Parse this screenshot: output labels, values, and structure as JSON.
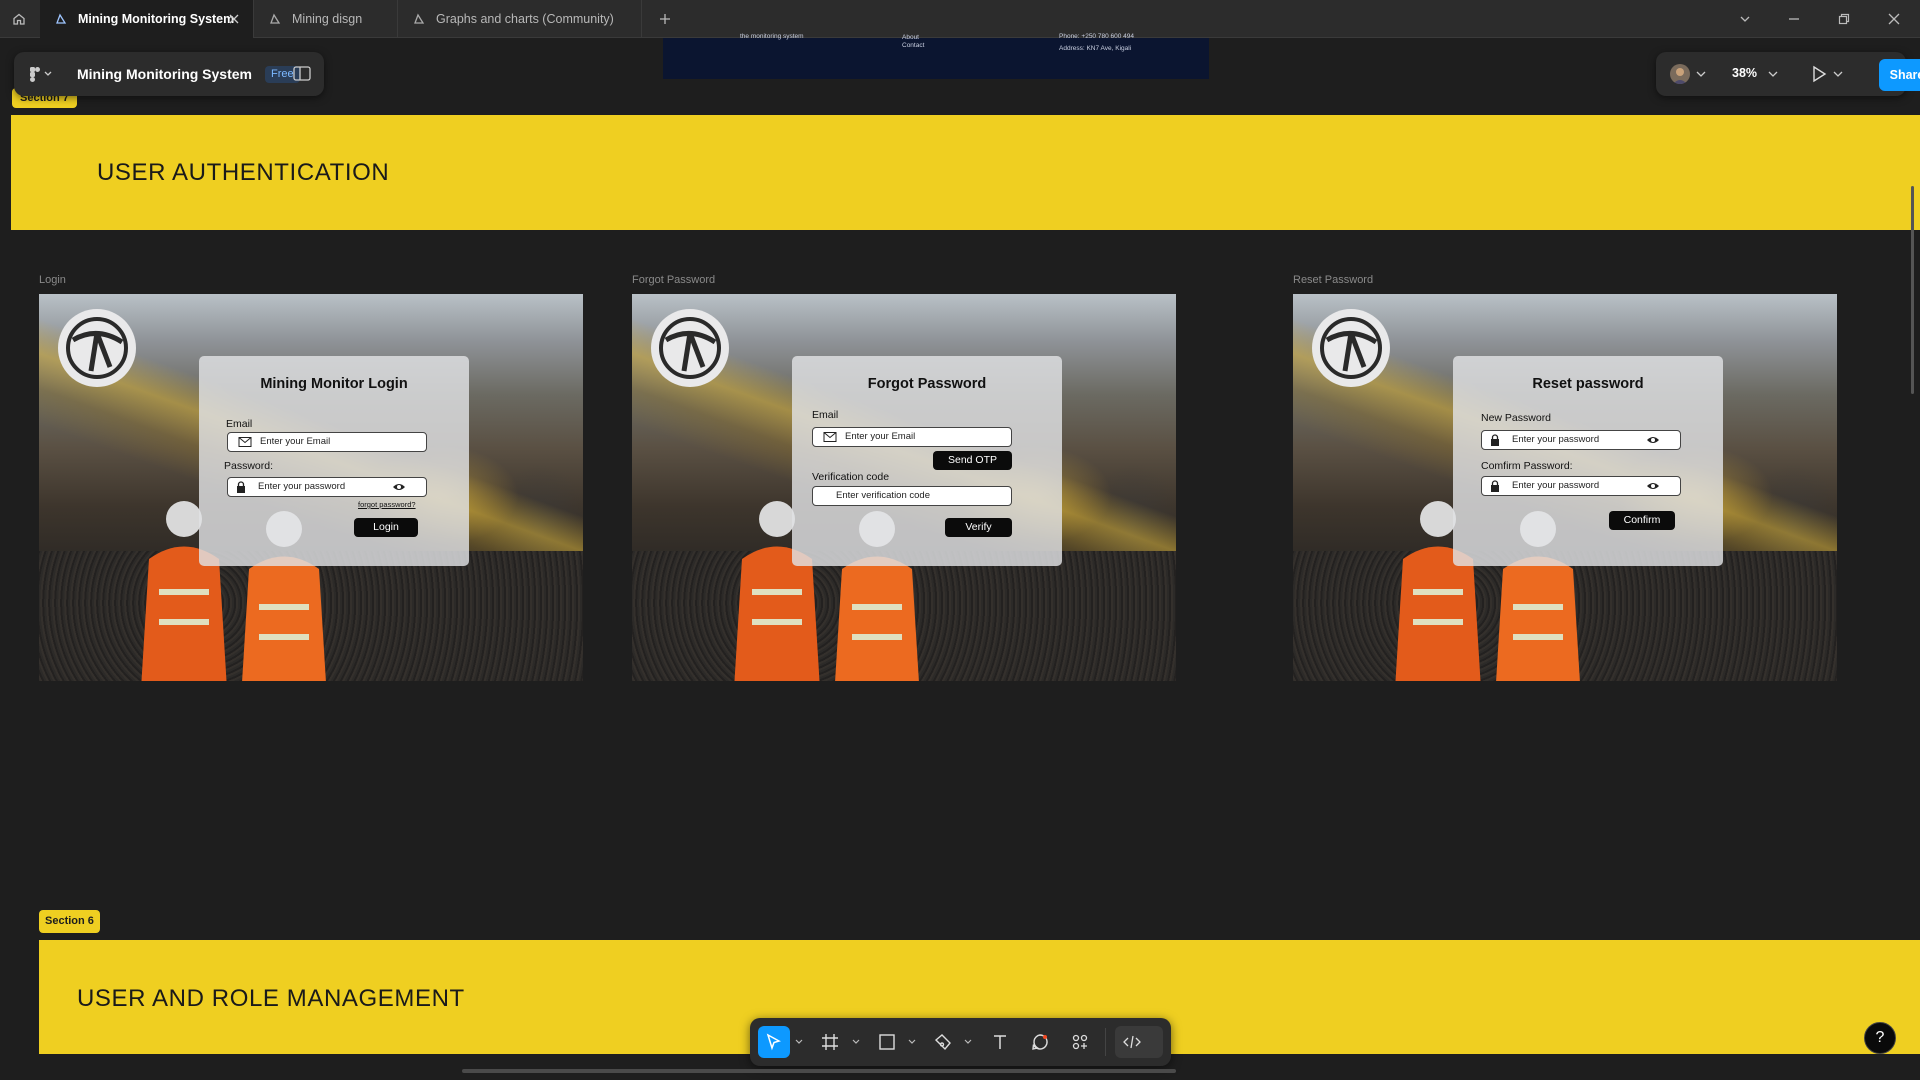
{
  "tabs": [
    {
      "label": "Mining Monitoring System",
      "active": true
    },
    {
      "label": "Mining disgn",
      "active": false
    },
    {
      "label": "Graphs and charts (Community)",
      "active": false
    }
  ],
  "file": {
    "name": "Mining Monitoring System",
    "plan_badge": "Free"
  },
  "view": {
    "zoom": "38%",
    "share_label": "Share"
  },
  "footer_peek": {
    "col1": "the monitoring system",
    "col2a": "About",
    "col2b": "Contact",
    "col3a": "Phone: +250 780 600 494",
    "col3b": "Address: KN7 Ave, Kigali"
  },
  "sections": {
    "section7": {
      "badge": "Section 7",
      "title": "USER AUTHENTICATION"
    },
    "section6": {
      "badge": "Section 6",
      "title": "USER AND ROLE MANAGEMENT"
    }
  },
  "frames": {
    "login": {
      "frame_label": "Login",
      "title": "Mining Monitor Login",
      "email_label": "Email",
      "email_placeholder": "Enter your  Email",
      "password_label": "Password:",
      "password_placeholder": "Enter your password",
      "forgot_link": "forgot password?",
      "button": "Login"
    },
    "forgot": {
      "frame_label": "Forgot Password",
      "title": "Forgot Password",
      "email_label": "Email",
      "email_placeholder": "Enter your  Email",
      "send_button": "Send OTP",
      "code_label": "Verification code",
      "code_placeholder": "Enter  verification code",
      "verify_button": "Verify"
    },
    "reset": {
      "frame_label": "Reset Password",
      "title": "Reset password",
      "new_label": "New Password",
      "new_placeholder": "Enter your password",
      "confirm_label": "Comfirm  Password:",
      "confirm_placeholder": "Enter your password",
      "button": "Confirm"
    }
  },
  "help": {
    "label": "?"
  },
  "colors": {
    "section": "#efcf21",
    "accent": "#0d99ff",
    "canvas": "#1e1e1e",
    "chrome": "#2c2c2c"
  },
  "icons": [
    "home-icon",
    "figma-file-icon",
    "close-icon",
    "plus-icon",
    "chevron-down-icon",
    "minimize-icon",
    "restore-icon",
    "window-close-icon",
    "figma-menu-icon",
    "sidebar-toggle-icon",
    "play-icon",
    "move-tool-icon",
    "frame-tool-icon",
    "rectangle-tool-icon",
    "pen-tool-icon",
    "text-tool-icon",
    "comment-tool-icon",
    "actions-icon",
    "dev-mode-icon",
    "mail-icon",
    "lock-icon",
    "eye-icon",
    "pickaxe-logo-icon"
  ]
}
